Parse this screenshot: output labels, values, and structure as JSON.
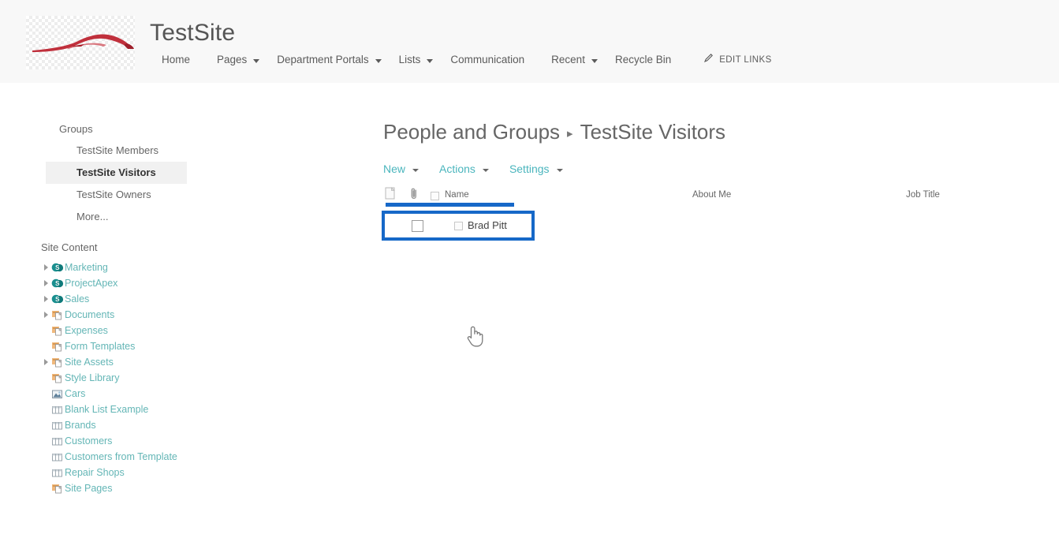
{
  "header": {
    "site_title": "TestSite",
    "logo_icon": "car-silhouette-logo",
    "nav": [
      {
        "label": "Home",
        "has_caret": false,
        "icon": ""
      },
      {
        "label": "Pages",
        "has_caret": true,
        "icon": "chevron-down-icon"
      },
      {
        "label": "Department Portals",
        "has_caret": true,
        "icon": "chevron-down-icon"
      },
      {
        "label": "Lists",
        "has_caret": true,
        "icon": "chevron-down-icon"
      },
      {
        "label": "Communication",
        "has_caret": false,
        "icon": ""
      },
      {
        "label": "Recent",
        "has_caret": true,
        "icon": "chevron-down-icon"
      },
      {
        "label": "Recycle Bin",
        "has_caret": false,
        "icon": ""
      }
    ],
    "edit_links": {
      "label": "EDIT LINKS",
      "icon": "pencil-icon"
    }
  },
  "sidebar": {
    "groups_heading": "Groups",
    "groups": [
      {
        "label": "TestSite Members",
        "selected": false
      },
      {
        "label": "TestSite Visitors",
        "selected": true
      },
      {
        "label": "TestSite Owners",
        "selected": false
      },
      {
        "label": "More...",
        "selected": false
      }
    ],
    "site_content_heading": "Site Content",
    "site_content": [
      {
        "label": "Marketing",
        "icon": "sharepoint-site-icon",
        "expandable": true
      },
      {
        "label": "ProjectApex",
        "icon": "sharepoint-site-icon",
        "expandable": true
      },
      {
        "label": "Sales",
        "icon": "sharepoint-site-icon",
        "expandable": true
      },
      {
        "label": "Documents",
        "icon": "document-library-icon",
        "expandable": true
      },
      {
        "label": "Expenses",
        "icon": "document-library-icon",
        "expandable": false
      },
      {
        "label": "Form Templates",
        "icon": "document-library-icon",
        "expandable": false
      },
      {
        "label": "Site Assets",
        "icon": "document-library-icon",
        "expandable": true
      },
      {
        "label": "Style Library",
        "icon": "document-library-icon",
        "expandable": false
      },
      {
        "label": "Cars",
        "icon": "picture-library-icon",
        "expandable": false
      },
      {
        "label": "Blank List Example",
        "icon": "list-icon",
        "expandable": false
      },
      {
        "label": "Brands",
        "icon": "list-icon",
        "expandable": false
      },
      {
        "label": "Customers",
        "icon": "list-icon",
        "expandable": false
      },
      {
        "label": "Customers from Template",
        "icon": "list-icon",
        "expandable": false
      },
      {
        "label": "Repair Shops",
        "icon": "list-icon",
        "expandable": false
      },
      {
        "label": "Site Pages",
        "icon": "document-library-icon",
        "expandable": false
      }
    ]
  },
  "main": {
    "breadcrumb": {
      "parent": "People and Groups",
      "separator": "▸",
      "current": "TestSite Visitors"
    },
    "toolbar": [
      {
        "label": "New",
        "has_caret": true,
        "icon": "chevron-down-icon"
      },
      {
        "label": "Actions",
        "has_caret": true,
        "icon": "chevron-down-icon"
      },
      {
        "label": "Settings",
        "has_caret": true,
        "icon": "chevron-down-icon"
      }
    ],
    "table": {
      "columns": {
        "doc_icon": "document-icon",
        "attach_icon": "paperclip-icon",
        "name": "Name",
        "about_me": "About Me",
        "job_title": "Job Title"
      },
      "rows": [
        {
          "selected": false,
          "name": "Brad Pitt",
          "about_me": "",
          "job_title": ""
        }
      ]
    }
  },
  "annotations": {
    "highlight_color": "#1668c8",
    "header_underline_color": "#1668c8",
    "cursor_icon": "pointing-hand-cursor"
  },
  "colors": {
    "header_band": "#f8f8f8",
    "link_teal": "#64b6b6",
    "toolbar_teal": "#4ab5bd",
    "text_gray": "#666666",
    "logo_red": "#b5222e"
  }
}
